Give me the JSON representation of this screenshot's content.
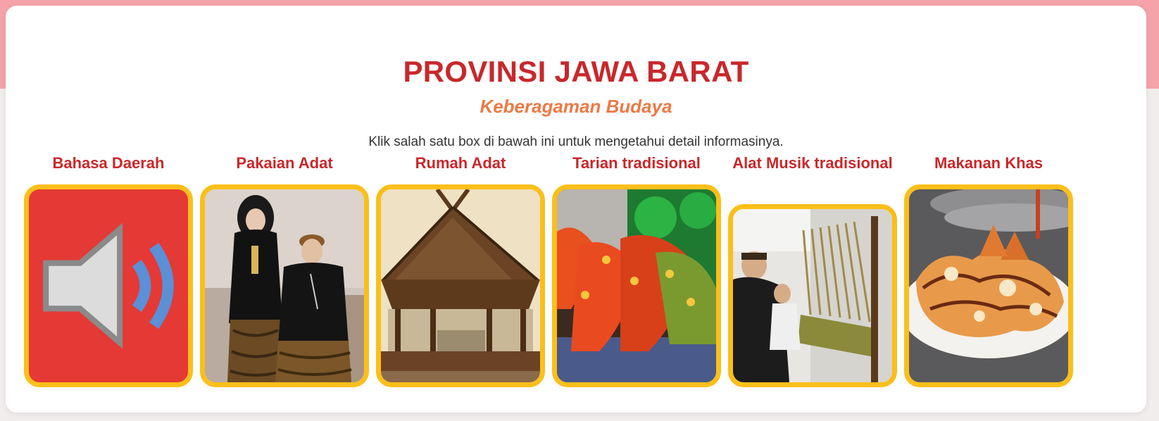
{
  "header": {
    "title": "PROVINSI JAWA BARAT",
    "subtitle": "Keberagaman Budaya",
    "instruction": "Klik salah satu box di bawah ini untuk mengetahui detail informasinya."
  },
  "items": [
    {
      "label": "Bahasa Daerah",
      "image": "speaker-icon"
    },
    {
      "label": "Pakaian Adat",
      "image": "traditional-clothing-photo"
    },
    {
      "label": "Rumah Adat",
      "image": "traditional-house-photo"
    },
    {
      "label": "Tarian tradisional",
      "image": "traditional-dance-photo"
    },
    {
      "label": "Alat Musik tradisional",
      "image": "angklung-photo"
    },
    {
      "label": "Makanan Khas",
      "image": "traditional-food-photo"
    }
  ],
  "colors": {
    "title": "#c8282b",
    "subtitle": "#ec7a45",
    "box_border": "#fbbf1a",
    "bahasa_bg": "#e53935",
    "top_band": "#f5a3a9"
  }
}
